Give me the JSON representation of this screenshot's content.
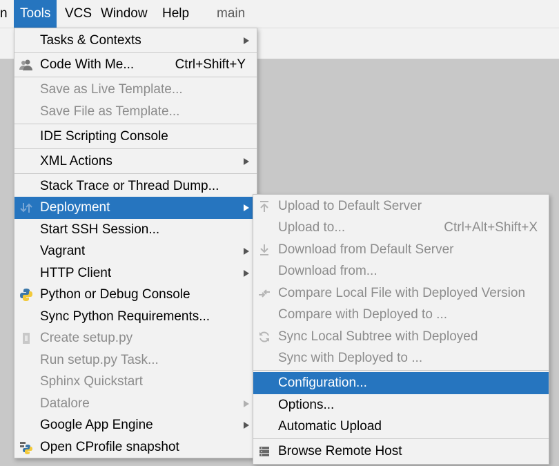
{
  "menubar": {
    "items": [
      {
        "label": "n"
      },
      {
        "label": "Tools"
      },
      {
        "label": "VCS"
      },
      {
        "label": "Window"
      },
      {
        "label": "Help"
      },
      {
        "label": "main"
      }
    ]
  },
  "tools_menu": {
    "items": [
      {
        "label": "Tasks & Contexts",
        "submenu": true
      },
      {
        "label": "Code With Me...",
        "shortcut": "Ctrl+Shift+Y",
        "icon": "people-icon"
      },
      {
        "label": "Save as Live Template...",
        "disabled": true
      },
      {
        "label": "Save File as Template...",
        "disabled": true
      },
      {
        "label": "IDE Scripting Console"
      },
      {
        "label": "XML Actions",
        "submenu": true
      },
      {
        "label": "Stack Trace or Thread Dump..."
      },
      {
        "label": "Deployment",
        "submenu": true,
        "selected": true,
        "icon": "deploy-arrows-icon"
      },
      {
        "label": "Start SSH Session..."
      },
      {
        "label": "Vagrant",
        "submenu": true
      },
      {
        "label": "HTTP Client",
        "submenu": true
      },
      {
        "label": "Python or Debug Console",
        "icon": "python-icon"
      },
      {
        "label": "Sync Python Requirements..."
      },
      {
        "label": "Create setup.py",
        "disabled": true,
        "icon": "setup-py-icon"
      },
      {
        "label": "Run setup.py Task...",
        "disabled": true
      },
      {
        "label": "Sphinx Quickstart",
        "disabled": true
      },
      {
        "label": "Datalore",
        "disabled": true,
        "submenu": true
      },
      {
        "label": "Google App Engine",
        "submenu": true
      },
      {
        "label": "Open CProfile snapshot",
        "icon": "cprofile-icon"
      }
    ]
  },
  "deploy_menu": {
    "items": [
      {
        "label": "Upload to Default Server",
        "disabled": true,
        "icon": "upload-icon"
      },
      {
        "label": "Upload to...",
        "shortcut": "Ctrl+Alt+Shift+X",
        "disabled": true
      },
      {
        "label": "Download from Default Server",
        "disabled": true,
        "icon": "download-icon"
      },
      {
        "label": "Download from...",
        "disabled": true
      },
      {
        "label": "Compare Local File with Deployed Version",
        "disabled": true,
        "icon": "compare-icon"
      },
      {
        "label": "Compare with Deployed to ...",
        "disabled": true
      },
      {
        "label": "Sync Local Subtree with Deployed",
        "disabled": true,
        "icon": "sync-icon"
      },
      {
        "label": "Sync with Deployed to ...",
        "disabled": true
      },
      {
        "label": "Configuration...",
        "selected": true
      },
      {
        "label": "Options..."
      },
      {
        "label": "Automatic Upload"
      },
      {
        "label": "Browse Remote Host",
        "icon": "remote-host-icon"
      }
    ]
  },
  "colors": {
    "accent": "#2675bf",
    "menu_bg": "#f2f2f2",
    "disabled_text": "#8c8c8c"
  }
}
